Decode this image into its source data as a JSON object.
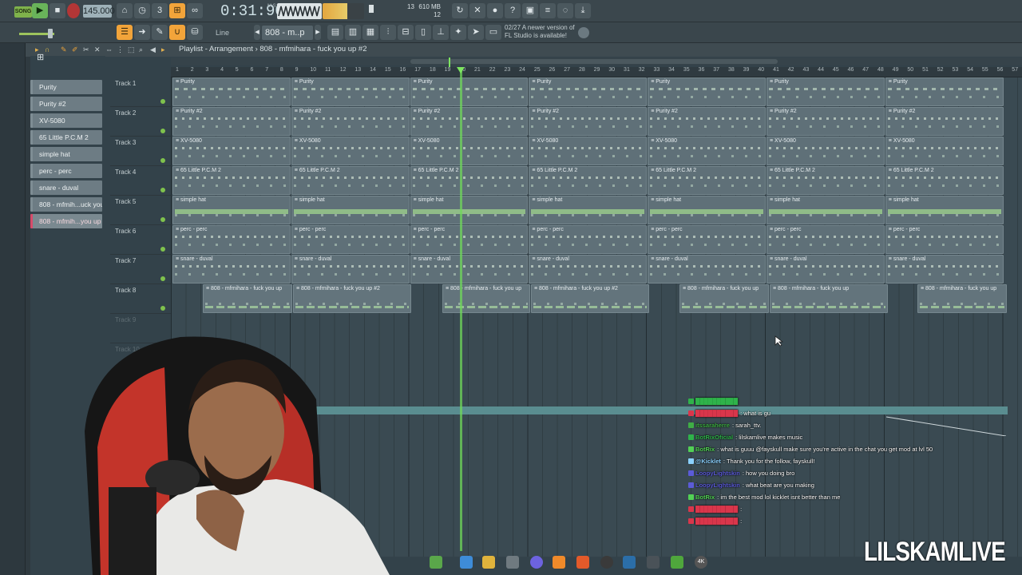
{
  "toolbar": {
    "song_mode": "SONG",
    "tempo": "145.000",
    "time": "0:31:90",
    "time_unit": "M:S:CS",
    "memory": "610 MB",
    "polyphony_a": "13",
    "polyphony_b": "12",
    "snap_label": "Line",
    "pattern_selector": "808 - m..p #2",
    "news_line1": "02/27  A newer version of",
    "news_line2": "FL Studio is available!"
  },
  "playlist": {
    "title": "Playlist - Arrangement › 808 - mfmihara - fuck you up #2",
    "ruler": [
      "1",
      "2",
      "3",
      "4",
      "5",
      "6",
      "7",
      "8",
      "9",
      "10",
      "11",
      "12",
      "13",
      "14",
      "15",
      "16",
      "17",
      "18",
      "19",
      "20",
      "21",
      "22",
      "23",
      "24",
      "25",
      "26",
      "27",
      "28",
      "29",
      "30",
      "31",
      "32",
      "33",
      "34",
      "35",
      "36",
      "37",
      "38",
      "39",
      "40",
      "41",
      "42",
      "43",
      "44",
      "45",
      "46",
      "47",
      "48",
      "49",
      "50",
      "51",
      "52",
      "53",
      "54",
      "55",
      "56",
      "57"
    ],
    "tracks": [
      {
        "name": "Track 1"
      },
      {
        "name": "Track 2"
      },
      {
        "name": "Track 3"
      },
      {
        "name": "Track 4"
      },
      {
        "name": "Track 5"
      },
      {
        "name": "Track 6"
      },
      {
        "name": "Track 7"
      },
      {
        "name": "Track 8"
      },
      {
        "name": "Track 9"
      },
      {
        "name": "Track 10"
      }
    ]
  },
  "patterns": [
    {
      "label": "Purity"
    },
    {
      "label": "Purity #2"
    },
    {
      "label": "XV-5080"
    },
    {
      "label": "65 Little P.C.M 2"
    },
    {
      "label": "simple hat"
    },
    {
      "label": "perc - perc"
    },
    {
      "label": "snare - duval"
    },
    {
      "label": "808 - mfmih...uck you up"
    },
    {
      "label": "808 - mfmih...you up #2"
    }
  ],
  "clips": {
    "t1": "Purity",
    "t2": "Purity #2",
    "t3": "XV-5080",
    "t4": "65 Little P.C.M 2",
    "t5": "simple hat",
    "t6": "perc - perc",
    "t7": "snare - duval",
    "t8a": "808 - mfmihara - fuck you up",
    "t8b": "808 - mfmihara - fuck you up #2",
    "t8c": "808 - mfmihara - fuck you up"
  },
  "chat": [
    {
      "user": "",
      "msg": "",
      "color": "#2fb24a"
    },
    {
      "user": "",
      "msg": ": what is gu",
      "color": "#d9364b"
    },
    {
      "user": "itssaraherre",
      "msg": ": sarah_ttv.",
      "color": "#3fae45"
    },
    {
      "user": "BotRixOficial",
      "msg": ": lilskamlive makes music",
      "color": "#2fb24a"
    },
    {
      "user": "BotRix",
      "msg": ": what is guuu @fayskull make sure you're active in the chat you get mod at lvl 50",
      "color": "#52d155"
    },
    {
      "user": "@Kicklet",
      "msg": ": Thank you for the follow, fayskull!",
      "color": "#8bd1ff"
    },
    {
      "user": "LoopyLightskin",
      "msg": ": how you doing bro",
      "color": "#5b5bd8"
    },
    {
      "user": "LoopyLightskin",
      "msg": ": what beat are you making",
      "color": "#5b5bd8"
    },
    {
      "user": "BotRix",
      "msg": ": im the best mod lol kicklet isnt better than me",
      "color": "#52d155"
    },
    {
      "user": "",
      "msg": ":",
      "color": "#d9364b"
    },
    {
      "user": "",
      "msg": ":",
      "color": "#d9364b"
    }
  ],
  "watermark": "LILSKAMLIVE",
  "icons": [
    "play-icon",
    "stop-icon",
    "record-icon",
    "metronome-icon",
    "undo-icon",
    "save-icon",
    "magnet-icon",
    "pencil-icon",
    "brush-icon",
    "mute-icon",
    "slice-icon",
    "select-icon",
    "zoom-icon",
    "speaker-icon",
    "cursor-icon"
  ],
  "colors": {
    "accent": "#f2a43a",
    "playhead": "#6fd85a",
    "chat_bot": "#52d155",
    "selected_pattern": "#d64b6a"
  }
}
